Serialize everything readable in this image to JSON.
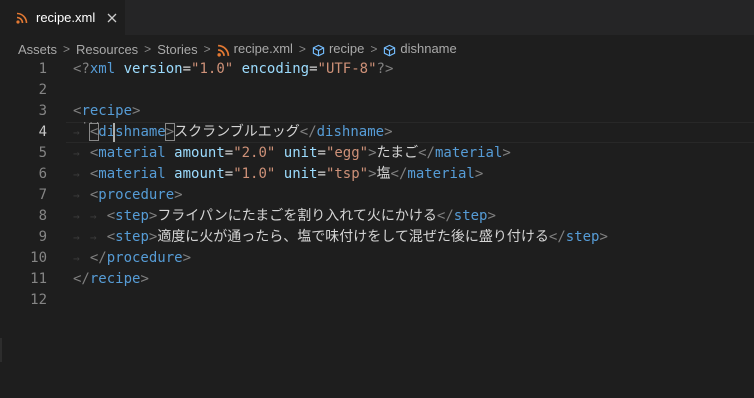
{
  "tab": {
    "label": "recipe.xml",
    "icon": "rss-icon",
    "close_icon": "close-icon"
  },
  "breadcrumb": {
    "items": [
      {
        "label": "Assets"
      },
      {
        "label": "Resources"
      },
      {
        "label": "Stories"
      },
      {
        "label": "recipe.xml",
        "icon": "rss-icon"
      },
      {
        "label": "recipe",
        "icon": "cube-icon"
      },
      {
        "label": "dishname",
        "icon": "cube-icon"
      }
    ],
    "separator": ">"
  },
  "editor": {
    "current_line": 4,
    "lines": [
      {
        "n": "1",
        "tokens": [
          [
            "t",
            "<?"
          ],
          [
            "n",
            "xml"
          ],
          [
            "x",
            " "
          ],
          [
            "a",
            "version"
          ],
          [
            "x",
            "="
          ],
          [
            "s",
            "\"1.0\""
          ],
          [
            "x",
            " "
          ],
          [
            "a",
            "encoding"
          ],
          [
            "x",
            "="
          ],
          [
            "s",
            "\"UTF-8\""
          ],
          [
            "t",
            "?>"
          ]
        ]
      },
      {
        "n": "2",
        "tokens": []
      },
      {
        "n": "3",
        "tokens": [
          [
            "t",
            "<"
          ],
          [
            "n",
            "recipe"
          ],
          [
            "t",
            ">"
          ]
        ]
      },
      {
        "n": "4",
        "tokens": [
          [
            "x",
            "  "
          ],
          [
            "t",
            "<"
          ],
          [
            "n",
            "dishname"
          ],
          [
            "t",
            ">"
          ],
          [
            "x",
            "スクランブルエッグ"
          ],
          [
            "t",
            "</"
          ],
          [
            "n",
            "dishname"
          ],
          [
            "t",
            ">"
          ]
        ]
      },
      {
        "n": "5",
        "tokens": [
          [
            "x",
            "  "
          ],
          [
            "t",
            "<"
          ],
          [
            "n",
            "material"
          ],
          [
            "x",
            " "
          ],
          [
            "a",
            "amount"
          ],
          [
            "x",
            "="
          ],
          [
            "s",
            "\"2.0\""
          ],
          [
            "x",
            " "
          ],
          [
            "a",
            "unit"
          ],
          [
            "x",
            "="
          ],
          [
            "s",
            "\"egg\""
          ],
          [
            "t",
            ">"
          ],
          [
            "x",
            "たまご"
          ],
          [
            "t",
            "</"
          ],
          [
            "n",
            "material"
          ],
          [
            "t",
            ">"
          ]
        ]
      },
      {
        "n": "6",
        "tokens": [
          [
            "x",
            "  "
          ],
          [
            "t",
            "<"
          ],
          [
            "n",
            "material"
          ],
          [
            "x",
            " "
          ],
          [
            "a",
            "amount"
          ],
          [
            "x",
            "="
          ],
          [
            "s",
            "\"1.0\""
          ],
          [
            "x",
            " "
          ],
          [
            "a",
            "unit"
          ],
          [
            "x",
            "="
          ],
          [
            "s",
            "\"tsp\""
          ],
          [
            "t",
            ">"
          ],
          [
            "x",
            "塩"
          ],
          [
            "t",
            "</"
          ],
          [
            "n",
            "material"
          ],
          [
            "t",
            ">"
          ]
        ]
      },
      {
        "n": "7",
        "tokens": [
          [
            "x",
            "  "
          ],
          [
            "t",
            "<"
          ],
          [
            "n",
            "procedure"
          ],
          [
            "t",
            ">"
          ]
        ]
      },
      {
        "n": "8",
        "tokens": [
          [
            "x",
            "    "
          ],
          [
            "t",
            "<"
          ],
          [
            "n",
            "step"
          ],
          [
            "t",
            ">"
          ],
          [
            "x",
            "フライパンにたまごを割り入れて火にかける"
          ],
          [
            "t",
            "</"
          ],
          [
            "n",
            "step"
          ],
          [
            "t",
            ">"
          ]
        ]
      },
      {
        "n": "9",
        "tokens": [
          [
            "x",
            "    "
          ],
          [
            "t",
            "<"
          ],
          [
            "n",
            "step"
          ],
          [
            "t",
            ">"
          ],
          [
            "x",
            "適度に火が通ったら、塩で味付けをして混ぜた後に盛り付ける"
          ],
          [
            "t",
            "</"
          ],
          [
            "n",
            "step"
          ],
          [
            "t",
            ">"
          ]
        ]
      },
      {
        "n": "10",
        "tokens": [
          [
            "x",
            "  "
          ],
          [
            "t",
            "</"
          ],
          [
            "n",
            "procedure"
          ],
          [
            "t",
            ">"
          ]
        ]
      },
      {
        "n": "11",
        "tokens": [
          [
            "t",
            "</"
          ],
          [
            "n",
            "recipe"
          ],
          [
            "t",
            ">"
          ]
        ]
      },
      {
        "n": "12",
        "tokens": []
      }
    ]
  },
  "colors": {
    "background": "#1e1e1e",
    "tag_punct": "#808080",
    "tag_name": "#569cd6",
    "attr_name": "#9cdcfe",
    "attr_value": "#ce9178",
    "text": "#d4d4d4",
    "rss_icon": "#e37933",
    "cube_icon": "#75beff"
  }
}
